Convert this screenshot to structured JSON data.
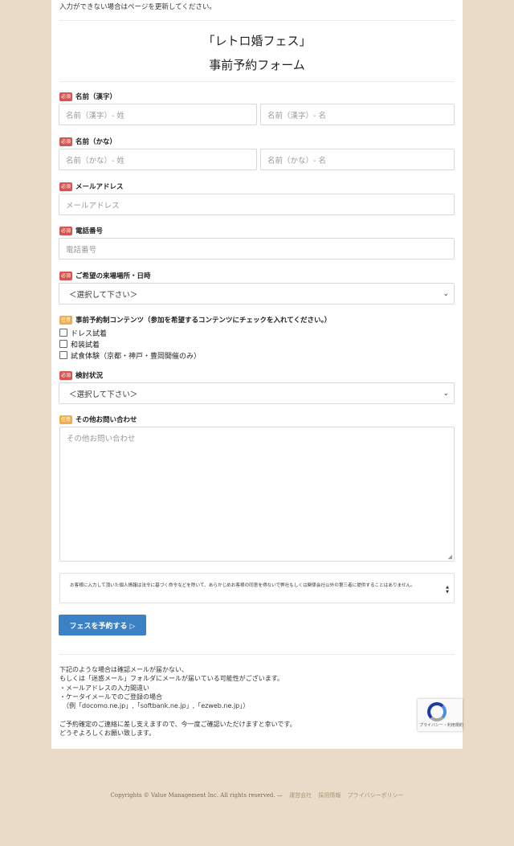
{
  "top_note": "入力ができない場合はページを更新してください。",
  "form": {
    "title": "「レトロ婚フェス」",
    "subtitle": "事前予約フォーム",
    "required_badge": "必須",
    "optional_badge": "任意",
    "fields": {
      "name_kanji": {
        "label": "名前（漢字）",
        "last_placeholder": "名前（漢字）- 姓",
        "first_placeholder": "名前（漢字）- 名"
      },
      "name_kana": {
        "label": "名前（かな）",
        "last_placeholder": "名前（かな）- 姓",
        "first_placeholder": "名前（かな）- 名"
      },
      "email": {
        "label": "メールアドレス",
        "placeholder": "メールアドレス"
      },
      "phone": {
        "label": "電話番号",
        "placeholder": "電話番号"
      },
      "venue": {
        "label": "ご希望の来場場所・日時",
        "selected": "＜選択して下さい＞"
      },
      "contents": {
        "label": "事前予約制コンテンツ（参加を希望するコンテンツにチェックを入れてください。）",
        "options": [
          "ドレス試着",
          "和装試着",
          "試食体験（京都・神戸・豊岡開催のみ）"
        ]
      },
      "status": {
        "label": "検討状況",
        "selected": "＜選択して下さい＞"
      },
      "inquiry": {
        "label": "その他お問い合わせ",
        "placeholder": "その他お問い合わせ"
      }
    },
    "privacy_text": "お客様に入力して頂いた個人情報は法令に基づく命令などを除いて、あらかじめお客様の同意を得ないで弊社もしくは関係会社以外の第三者に提供することはありません。",
    "submit_label": "フェスを予約する ▷"
  },
  "notice": {
    "lines": [
      "下記のような場合は確認メールが届かない、",
      "もしくは「迷惑メール」フォルダにメールが届いている可能性がございます。",
      "・メールアドレスの入力間違い",
      "・ケータイメールでのご登録の場合",
      "　（例「docomo.ne.jp」,「softbank.ne.jp」,「ezweb.ne.jp」）",
      "",
      "ご予約確定のご連絡に差し支えますので、今一度ご確認いただけますと幸いです。",
      "どうぞよろしくお願い致します。"
    ]
  },
  "recaptcha": {
    "text": "プライバシー・利用規約"
  },
  "footer": {
    "copyright": "Copyrights © Value Management Inc. All rights reserved. —",
    "links": [
      "運営会社",
      "採用情報",
      "プライバシーポリシー"
    ]
  },
  "colors": {
    "background": "#eadbc8",
    "required": "#d9534f",
    "optional": "#f0ad4e",
    "button": "#3b82c4"
  },
  "icons": [
    "chevron-down-icon",
    "checkbox-icon",
    "resize-handle-icon",
    "recaptcha-logo-icon"
  ]
}
